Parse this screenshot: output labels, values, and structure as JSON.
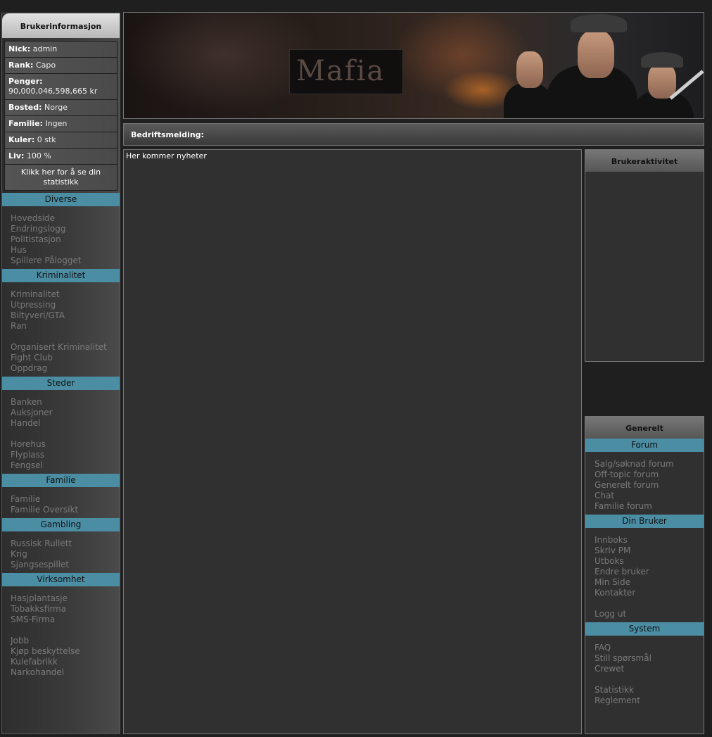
{
  "user_info": {
    "title": "Brukerinformasjon",
    "rows": [
      {
        "label": "Nick:",
        "value": "admin"
      },
      {
        "label": "Rank:",
        "value": "Capo"
      },
      {
        "label": "Penger:",
        "value": "90,000,046,598,665 kr"
      },
      {
        "label": "Bosted:",
        "value": "Norge"
      },
      {
        "label": "Familie:",
        "value": "Ingen"
      },
      {
        "label": "Kuler:",
        "value": "0 stk"
      },
      {
        "label": "Liv:",
        "value": "100 %"
      }
    ],
    "stats_link": "Klikk her for å se din statistikk"
  },
  "left_nav": [
    {
      "title": "Diverse",
      "items": [
        "Hovedside",
        "Endringslogg",
        "Politistasjon",
        "Hus",
        "Spillere Pålogget"
      ]
    },
    {
      "title": "Kriminalitet",
      "items": [
        "Kriminalitet",
        "Utpressing",
        "Biltyveri/GTA",
        "Ran",
        "",
        "Organisert Kriminalitet",
        "Fight Club",
        "Oppdrag"
      ]
    },
    {
      "title": "Steder",
      "items": [
        "Banken",
        "Auksjoner",
        "Handel",
        "",
        "Horehus",
        "Flyplass",
        "Fengsel"
      ]
    },
    {
      "title": "Familie",
      "items": [
        "Familie",
        "Familie Oversikt"
      ]
    },
    {
      "title": "Gambling",
      "items": [
        "Russisk Rullett",
        "Krig",
        "Sjangsespillet"
      ]
    },
    {
      "title": "Virksomhet",
      "items": [
        "Hasjplantasje",
        "Tobakksfirma",
        "SMS-Firma",
        "",
        "Jobb",
        "Kjøp beskyttelse",
        "Kulefabrikk",
        "Narkohandel"
      ]
    }
  ],
  "banner": {
    "logo_text": "Mafia"
  },
  "company_message": {
    "label": "Bedriftsmelding:"
  },
  "news": {
    "text": "Her kommer nyheter"
  },
  "activity": {
    "title": "Brukeraktivitet"
  },
  "general": {
    "title": "Generelt",
    "sections": [
      {
        "title": "Forum",
        "items": [
          "Salg/søknad forum",
          "Off-topic forum",
          "Generelt forum",
          "Chat",
          "Familie forum"
        ]
      },
      {
        "title": "Din Bruker",
        "items": [
          "Innboks",
          "Skriv PM",
          "Utboks",
          "Endre bruker",
          "Min Side",
          "Kontakter",
          "",
          "Logg ut"
        ]
      },
      {
        "title": "System",
        "items": [
          "FAQ",
          "Still spørsmål",
          "Crewet",
          "",
          "Statistikk",
          "Reglement"
        ]
      }
    ]
  },
  "colors": {
    "accent": "#4b8ea3",
    "link": "#7a7a7a",
    "background": "#1f1f1f"
  }
}
